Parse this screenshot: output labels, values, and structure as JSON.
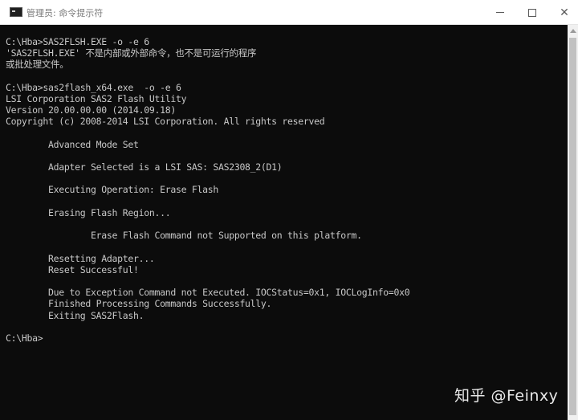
{
  "window": {
    "title": "管理员: 命令提示符",
    "icon": "console-app-icon",
    "controls": {
      "minimize": "minimize-icon",
      "maximize": "maximize-icon",
      "close_label": "✕"
    }
  },
  "console": {
    "lines": [
      "C:\\Hba>SAS2FLSH.EXE -o -e 6",
      "'SAS2FLSH.EXE' 不是内部或外部命令，也不是可运行的程序",
      "或批处理文件。",
      "",
      "C:\\Hba>sas2flash_x64.exe  -o -e 6",
      "LSI Corporation SAS2 Flash Utility",
      "Version 20.00.00.00 (2014.09.18)",
      "Copyright (c) 2008-2014 LSI Corporation. All rights reserved",
      "",
      "        Advanced Mode Set",
      "",
      "        Adapter Selected is a LSI SAS: SAS2308_2(D1)",
      "",
      "        Executing Operation: Erase Flash",
      "",
      "        Erasing Flash Region...",
      "",
      "                Erase Flash Command not Supported on this platform.",
      "",
      "        Resetting Adapter...",
      "        Reset Successful!",
      "",
      "        Due to Exception Command not Executed. IOCStatus=0x1, IOCLogInfo=0x0",
      "        Finished Processing Commands Successfully.",
      "        Exiting SAS2Flash.",
      "",
      "C:\\Hba>"
    ]
  },
  "watermark": {
    "text": "知乎 @Feinxy"
  },
  "colors": {
    "console_background": "#0c0c0c",
    "console_text": "#c8c8c8",
    "titlebar_background": "#ffffff",
    "title_text": "#7a7a7a"
  }
}
